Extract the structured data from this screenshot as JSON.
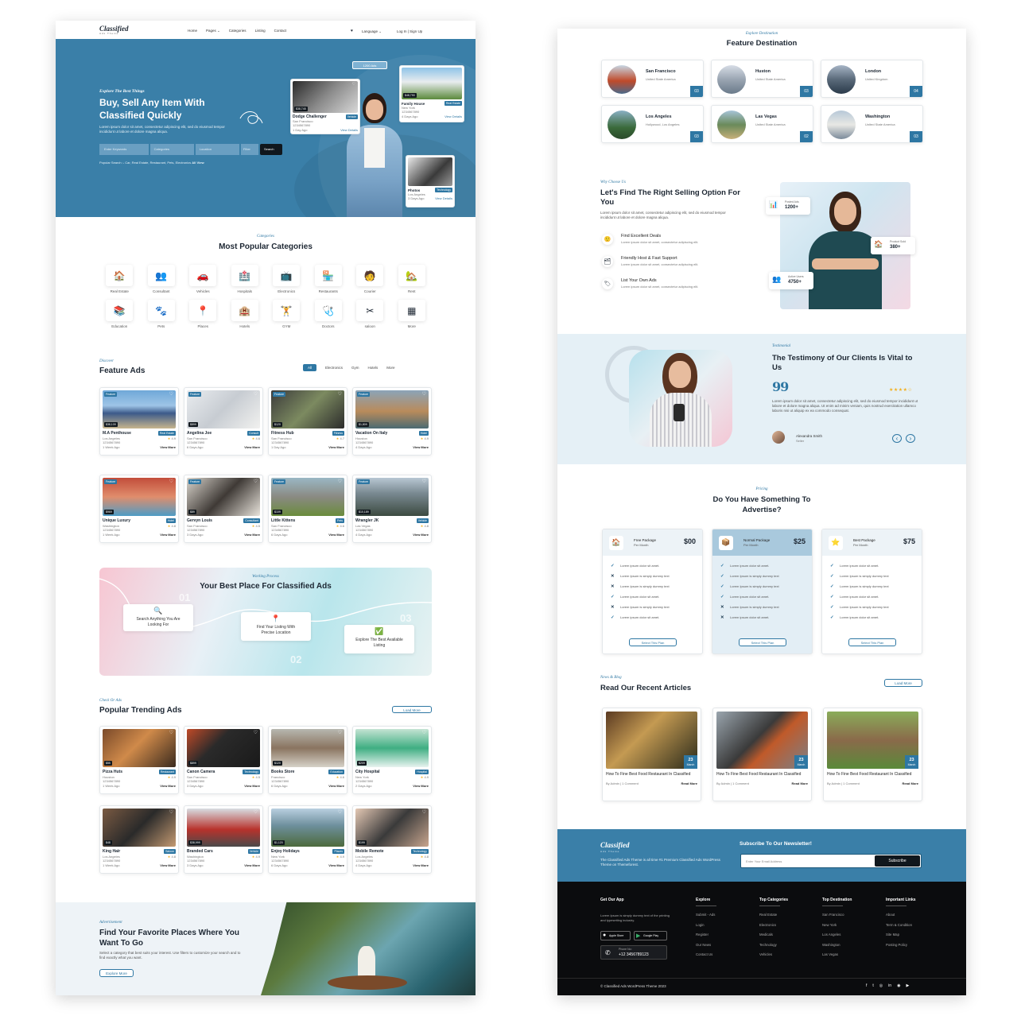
{
  "left": {
    "nav": {
      "logo": "Classified",
      "logo_sub": "Ads Theme",
      "items": [
        "Home",
        "Pages ⌄",
        "Categories",
        "Listing",
        "Contact"
      ],
      "language": "Language ⌄",
      "auth": "Log In | Sign Up"
    },
    "hero": {
      "eyebrow": "Explore The Best Things",
      "title": "Buy, Sell Any Item With Classified Quickly",
      "desc": "Lorem ipsum dolor sit amet, consectetur adipiscing elit, sed do eiusmod tempor incididunt ut labore et dolore magna aliqua.",
      "ph_keywords": "Enter Keywords",
      "ph_categories": "Categories",
      "ph_location": "Location",
      "ph_filter": "Filter",
      "search_btn": "Search",
      "popular": "Popular Search :- Car, Real Estate, Restaurant, Pets, Electronics",
      "all_view": "All View",
      "ads_badge": "1200 Ads",
      "card1": {
        "price": "$38,745",
        "title": "Dodge Challenger",
        "badge": "Vehicle",
        "loc": "San Francisco",
        "phone": "1234567890",
        "time": "1 Day Ago",
        "link": "View Details"
      },
      "card2": {
        "price": "$48,790",
        "title": "Family House",
        "badge": "Real Estate",
        "loc": "New York",
        "phone": "1234567890",
        "time": "4 Days Ago",
        "link": "View Details"
      },
      "card3": {
        "title": "Photos",
        "badge": "Technology",
        "loc": "Los Angeles",
        "time": "3 Days Ago",
        "link": "View Details"
      }
    },
    "categories": {
      "eyebrow": "Categories",
      "title": "Most Popular Categories",
      "items": [
        {
          "icon": "🏠",
          "label": "Real Estate"
        },
        {
          "icon": "👥",
          "label": "Consultant"
        },
        {
          "icon": "🚗",
          "label": "Vehicles"
        },
        {
          "icon": "🏥",
          "label": "Hospitals"
        },
        {
          "icon": "📺",
          "label": "Electronics"
        },
        {
          "icon": "🏪",
          "label": "Restaurants"
        },
        {
          "icon": "🧑",
          "label": "Courier"
        },
        {
          "icon": "🏡",
          "label": "Rent"
        },
        {
          "icon": "📚",
          "label": "Education"
        },
        {
          "icon": "🐾",
          "label": "Pets"
        },
        {
          "icon": "📍",
          "label": "Places"
        },
        {
          "icon": "🏨",
          "label": "Hotels"
        },
        {
          "icon": "🏋",
          "label": "GYM"
        },
        {
          "icon": "🩺",
          "label": "Doctors"
        },
        {
          "icon": "✂",
          "label": "saloon"
        },
        {
          "icon": "▦",
          "label": "More"
        }
      ]
    },
    "feature": {
      "eyebrow": "Discover",
      "title": "Feature Ads",
      "filters": [
        "All",
        "Electronics",
        "Gym",
        "Hotels",
        "More"
      ],
      "ads": [
        {
          "price": "$38,109",
          "title": "M.A Penthouse",
          "badge": "Real Estate",
          "loc": "Los Angeles",
          "phone": "1234567890",
          "time": "1 Week Ago",
          "rating": "4.9",
          "link": "View More",
          "bg": "linear-gradient(180deg,#6fa8d8 0%,#9ec4e6 40%,#3c5a8a 60%,#c7b58d 100%)"
        },
        {
          "price": "$899",
          "title": "Angelina Joe",
          "badge": "Consult",
          "loc": "San Francisco",
          "phone": "1234567890",
          "time": "6 Days Ago",
          "rating": "4.6",
          "link": "View More",
          "bg": "linear-gradient(135deg,#e9ecef 0%,#c7ccd2 50%,#f1f1ef 100%)"
        },
        {
          "price": "$120",
          "title": "Fitness Hub",
          "badge": "Fitness",
          "loc": "San Francisco",
          "phone": "1234567890",
          "time": "1 Day Ago",
          "rating": "4.7",
          "link": "View More",
          "bg": "linear-gradient(135deg,#3b3b3b 0%,#7c8a60 50%,#2b2b2b 100%)"
        },
        {
          "price": "$1,809",
          "title": "Vacation On Italy",
          "badge": "Hotel",
          "loc": "Houston",
          "phone": "1234567890",
          "time": "4 Days Ago",
          "rating": "4.9",
          "link": "View More",
          "bg": "linear-gradient(180deg,#8ba4b8 0%,#b98b5b 55%,#4b6a72 100%)"
        },
        {
          "price": "$969",
          "title": "Unique Luxury",
          "badge": "Hotel",
          "loc": "Washington",
          "phone": "1234567890",
          "time": "1 Week Ago",
          "rating": "4.8",
          "link": "View More",
          "bg": "linear-gradient(180deg,#c24d3b 0%,#e08d6c 50%,#4d9cc6 100%)"
        },
        {
          "price": "$89",
          "title": "Gervyn Louis",
          "badge": "Consultant",
          "loc": "San Francisco",
          "phone": "1234567890",
          "time": "3 Days Ago",
          "rating": "4.5",
          "link": "View More",
          "bg": "linear-gradient(135deg,#d9d4cc 0%,#3f3a36 50%,#e8e3db 100%)"
        },
        {
          "price": "$109",
          "title": "Little Kittens",
          "badge": "Pets",
          "loc": "San Francisco",
          "phone": "1234567890",
          "time": "6 Days Ago",
          "rating": "4.6",
          "link": "View More",
          "bg": "linear-gradient(180deg,#9ab7c4 0%,#8a8a82 50%,#6a8c3c 100%)"
        },
        {
          "price": "$10,189",
          "title": "Wrangler JK",
          "badge": "Vehicle",
          "loc": "Las Vegas",
          "phone": "1234567890",
          "time": "4 Days Ago",
          "rating": "4.8",
          "link": "View More",
          "bg": "linear-gradient(180deg,#b8c7d3 0%,#7a8a92 40%,#3c4a40 100%)"
        }
      ]
    },
    "process": {
      "eyebrow": "Working Process",
      "title": "Your Best Place For Classified Ads",
      "steps": [
        {
          "num": "01",
          "text": "Search Anything You Are Looking For",
          "icon": "🔍"
        },
        {
          "num": "02",
          "text": "Find Your Listing With Precise Location",
          "icon": "📍"
        },
        {
          "num": "03",
          "text": "Explore The Best Available Listing",
          "icon": "✅"
        }
      ]
    },
    "trending": {
      "eyebrow": "Check Or Ads",
      "title": "Popular Trending Ads",
      "load": "Load More",
      "ads": [
        {
          "price": "$55",
          "title": "Pizza Huts",
          "badge": "Restaurant",
          "loc": "Houston",
          "phone": "1234567890",
          "time": "1 Week Ago",
          "rating": "4.9",
          "link": "View More",
          "bg": "linear-gradient(135deg,#7a4a2a 0%,#d08a4a 45%,#3a2a1e 100%)"
        },
        {
          "price": "$899",
          "title": "Canon Camera",
          "badge": "Technology",
          "loc": "San Francisco",
          "phone": "1234567890",
          "time": "3 Days Ago",
          "rating": "4.5",
          "link": "View More",
          "bg": "linear-gradient(135deg,#c04a28 0%,#2a2a2a 40%,#1a1a1a 100%)"
        },
        {
          "price": "$120",
          "title": "Books Store",
          "badge": "Education",
          "loc": "Francisco",
          "phone": "1234567890",
          "time": "6 Days Ago",
          "rating": "4.6",
          "link": "View More",
          "bg": "linear-gradient(180deg,#b7b7b0 0%,#8a7460 50%,#d6d2c8 100%)"
        },
        {
          "price": "$209",
          "title": "City Hospital",
          "badge": "Hospital",
          "loc": "New York",
          "phone": "1234567890",
          "time": "2 Days Ago",
          "rating": "4.9",
          "link": "View More",
          "bg": "linear-gradient(180deg,#c4e3d3 0%,#3fae82 50%,#e8f3ef 100%)"
        },
        {
          "price": "$48",
          "title": "King Hair",
          "badge": "Saloon",
          "loc": "Los Angeles",
          "phone": "1234567890",
          "time": "1 Week Ago",
          "rating": "4.8",
          "link": "View More",
          "bg": "linear-gradient(135deg,#7a5a42 0%,#2a2a2a 50%,#c49a72 100%)"
        },
        {
          "price": "$38,999",
          "title": "Branded Cars",
          "badge": "Vehicle",
          "loc": "Washington",
          "phone": "1234567890",
          "time": "3 Days Ago",
          "rating": "4.9",
          "link": "View More",
          "bg": "linear-gradient(180deg,#d8dde2 0%,#b8322c 55%,#4a4a4a 100%)"
        },
        {
          "price": "$1,120",
          "title": "Enjoy Holidays",
          "badge": "Places",
          "loc": "New York",
          "phone": "1234567890",
          "time": "6 Days Ago",
          "rating": "4.9",
          "link": "View More",
          "bg": "linear-gradient(180deg,#b9cfe0 0%,#6d8f9c 45%,#4d6a3c 100%)"
        },
        {
          "price": "$199",
          "title": "Mobile Remote",
          "badge": "Technology",
          "loc": "Los Angeles",
          "phone": "1234567890",
          "time": "4 Days Ago",
          "rating": "4.8",
          "link": "View More",
          "bg": "linear-gradient(135deg,#e4c8b4 0%,#3a3a3a 50%,#c7a58e 100%)"
        }
      ]
    },
    "promo": {
      "eyebrow": "Advertisement",
      "title": "Find Your Favorite Places Where You Want To Go",
      "desc": "Select a category that best suits your interest. Use filters to customize your search and to find exactly what you want.",
      "btn": "Explore More"
    }
  },
  "right": {
    "destinations": {
      "eyebrow": "Explore Destination",
      "title": "Feature Destination",
      "items": [
        {
          "name": "San Francisco",
          "sub": "United State America",
          "count": "03",
          "bg": "linear-gradient(180deg,#c7d7e4 0%,#c04a2a 55%,#4a6a8a 100%)"
        },
        {
          "name": "Huston",
          "sub": "United State America",
          "count": "03",
          "bg": "linear-gradient(180deg,#d7dde6 0%,#9aa5b2 50%,#6a7a8a 100%)"
        },
        {
          "name": "London",
          "sub": "United Kingdom",
          "count": "04",
          "bg": "linear-gradient(180deg,#a7b5c6 0%,#5a6a7a 50%,#2a3a4a 100%)"
        },
        {
          "name": "Los Angeles",
          "sub": "Hollywood, Los Angeles",
          "count": "03",
          "bg": "linear-gradient(180deg,#8ab0c4 0%,#3a6a3a 60%,#2a4a2a 100%)"
        },
        {
          "name": "Las Vegas",
          "sub": "United State America",
          "count": "02",
          "bg": "linear-gradient(180deg,#a7c4d8 0%,#6a8a5a 50%,#c7b07a 100%)"
        },
        {
          "name": "Washington",
          "sub": "United State America",
          "count": "03",
          "bg": "linear-gradient(180deg,#b7c8d8 0%,#e8e8e4 50%,#7a8a9a 100%)"
        }
      ]
    },
    "why": {
      "eyebrow": "Why Choose Us",
      "title": "Let's Find The Right Selling Option For You",
      "desc": "Lorem ipsum dolor sit amet, consectetur adipiscing elit, sed do eiusmod tempor incididunt ut labore et dolore magna aliqua.",
      "features": [
        {
          "icon": "🙂",
          "title": "Find Excellent Deals",
          "text": "Lorem ipsum dolor sit amet, consectetur adipiscing elit."
        },
        {
          "icon": "🗂",
          "title": "Friendly Host & Fast Support",
          "text": "Lorem ipsum dolor sit amet, consectetur adipiscing elit."
        },
        {
          "icon": "🏷",
          "title": "List Your Own Ads",
          "text": "Lorem ipsum dolor sit amet, consectetur adipiscing elit."
        }
      ],
      "stats": [
        {
          "label": "Posted Ads",
          "value": "1200+"
        },
        {
          "label": "Product Sold",
          "value": "380+"
        },
        {
          "label": "Active Users",
          "value": "4750+"
        }
      ]
    },
    "testimonial": {
      "eyebrow": "Testimonial",
      "title": "The Testimony of Our Clients Is Vital to Us",
      "quote_mark": "99",
      "stars": "★★★★☆",
      "text": "Lorem ipsum dolor sit amet, consectetur adipiscing elit, sed do eiusmod tempor incididunt ut labore et dolore magna aliqua. Ut enim ad minim veniam, quis nostrud exercitation ullamco laboris nisi ut aliquip ex ea commodo consequat.",
      "name": "Alexandra Smith",
      "role": "Seller",
      "prev": "‹",
      "next": "›"
    },
    "pricing": {
      "eyebrow": "Pricing",
      "title": "Do You Have Something To Advertise?",
      "plans": [
        {
          "name": "Free Package",
          "period": "Per Month",
          "price": "$00",
          "icon": "🏠",
          "btn": "Select This Plan",
          "features": [
            {
              "ok": true,
              "text": "Lorem ipsum dolor sit amet."
            },
            {
              "ok": false,
              "text": "Lorem Ipsum is simply dummy text"
            },
            {
              "ok": false,
              "text": "Lorem Ipsum is simply dummy text"
            },
            {
              "ok": true,
              "text": "Lorem ipsum dolor sit amet."
            },
            {
              "ok": false,
              "text": "Lorem Ipsum is simply dummy text"
            },
            {
              "ok": true,
              "text": "Lorem ipsum dolor sit amet."
            }
          ]
        },
        {
          "name": "Normal Package",
          "period": "Per Month",
          "price": "$25",
          "icon": "📦",
          "btn": "Select This Plan",
          "features": [
            {
              "ok": true,
              "text": "Lorem ipsum dolor sit amet."
            },
            {
              "ok": true,
              "text": "Lorem Ipsum is simply dummy text"
            },
            {
              "ok": true,
              "text": "Lorem Ipsum is simply dummy text"
            },
            {
              "ok": true,
              "text": "Lorem ipsum dolor sit amet."
            },
            {
              "ok": false,
              "text": "Lorem Ipsum is simply dummy text"
            },
            {
              "ok": false,
              "text": "Lorem ipsum dolor sit amet."
            }
          ]
        },
        {
          "name": "Best Package",
          "period": "Per Month",
          "price": "$75",
          "icon": "⭐",
          "btn": "Select This Plan",
          "features": [
            {
              "ok": true,
              "text": "Lorem ipsum dolor sit amet."
            },
            {
              "ok": true,
              "text": "Lorem Ipsum is simply dummy text"
            },
            {
              "ok": true,
              "text": "Lorem Ipsum is simply dummy text"
            },
            {
              "ok": true,
              "text": "Lorem ipsum dolor sit amet."
            },
            {
              "ok": true,
              "text": "Lorem Ipsum is simply dummy text"
            },
            {
              "ok": true,
              "text": "Lorem ipsum dolor sit amet."
            }
          ]
        }
      ]
    },
    "blog": {
      "eyebrow": "News & Blog",
      "title": "Read Our Recent Articles",
      "load": "Load More",
      "posts": [
        {
          "day": "23",
          "month": "March",
          "title": "How To Fine Best Food Restaurant In Classified",
          "by": "By Admin",
          "comments": "1 Comment",
          "more": "Read More",
          "bg": "linear-gradient(135deg,#5a3a22 0%,#c49a52 40%,#2a2a1a 100%)"
        },
        {
          "day": "23",
          "month": "March",
          "title": "How To Fine Best Food Restaurant In Classified",
          "by": "By Admin",
          "comments": "1 Comment",
          "more": "Read More",
          "bg": "linear-gradient(135deg,#9aa5ae 0%,#3a3a3a 45%,#c05a2a 60%,#7a8088 100%)"
        },
        {
          "day": "23",
          "month": "March",
          "title": "How To Fine Best Food Restaurant In Classified",
          "by": "By Admin",
          "comments": "1 Comment",
          "more": "Read More",
          "bg": "linear-gradient(180deg,#8aac5a 0%,#8a6a4a 50%,#5a8a3a 100%)"
        }
      ]
    },
    "newsletter": {
      "logo": "Classified",
      "logo_sub": "Ads Theme",
      "desc": "The Classified Ads Theme is all time #1 Premium Classified Ads WordPress Theme on Themeforest.",
      "title": "Subscribe To Our Newsletter!",
      "placeholder": "Enter Your Email Address",
      "btn": "Subscribe"
    },
    "footer": {
      "app_title": "Get Our App",
      "app_text": "Lorem Ipsum is simply dummy text of the printing and typesetting industry.",
      "appstore": "Apple Store",
      "playstore": "Google Play",
      "phone_label": "Phone No:",
      "phone": "+12 3456789123",
      "cols": [
        {
          "title": "Explore",
          "items": [
            "Submit - Ads",
            "Login",
            "Register",
            "Our News",
            "Contact Us"
          ]
        },
        {
          "title": "Top Categories",
          "items": [
            "Real Estate",
            "Electronics",
            "Medicals",
            "Technology",
            "Vehicles"
          ]
        },
        {
          "title": "Top Destination",
          "items": [
            "San Francisco",
            "New York",
            "Los Angeles",
            "Washington",
            "Las Vegas"
          ]
        },
        {
          "title": "Important Links",
          "items": [
            "About",
            "Term & Condition",
            "Site Map",
            "Posting Policy"
          ]
        }
      ],
      "copyright": "© Classified Ads WordPress Theme 2023",
      "social": [
        "f",
        "t",
        "◎",
        "in",
        "◉",
        "▶"
      ]
    }
  },
  "colors": {
    "primary": "#3a7fa8",
    "accent": "#2e77a3",
    "dark": "#0b0c0e",
    "star": "#f2b01e"
  }
}
